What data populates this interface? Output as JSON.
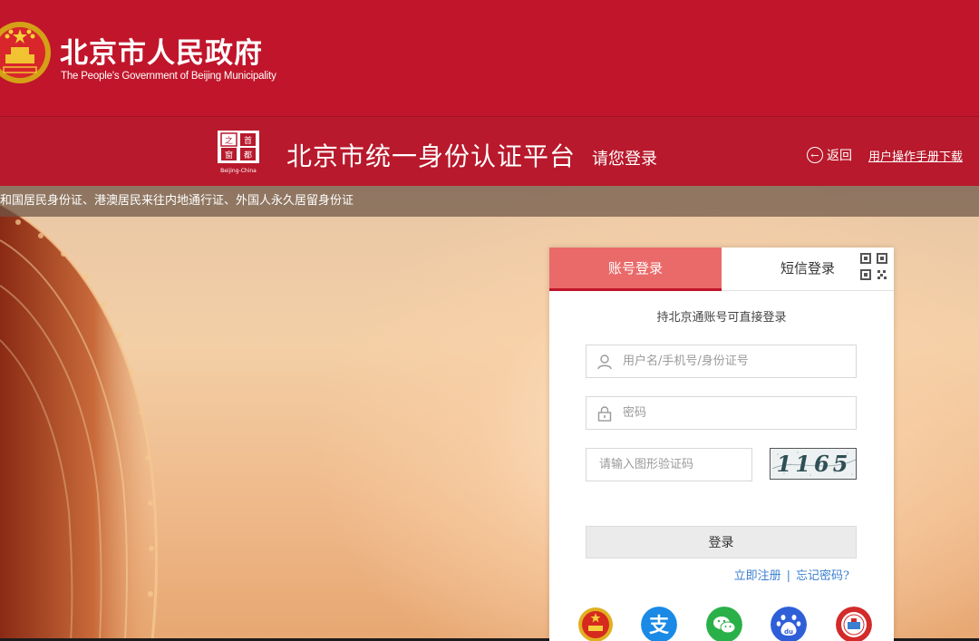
{
  "header": {
    "title": "北京市人民政府",
    "subtitle": "The People's Government of Beijing Municipality",
    "emblem_icon": "national-emblem-icon"
  },
  "platform": {
    "logo_icon": "capital-logo-icon",
    "logo_text": "Beijing-China",
    "title": "北京市统一身份认证平台",
    "subtitle": "请您登录",
    "back_label": "返回",
    "manual_label": "用户操作手册下载"
  },
  "notice": {
    "text": "和国居民身份证、港澳居民来往内地通行证、外国人永久居留身份证"
  },
  "login": {
    "tabs": [
      {
        "label": "账号登录",
        "active": true
      },
      {
        "label": "短信登录",
        "active": false
      }
    ],
    "qr_icon": "qrcode-icon",
    "hint": "持北京通账号可直接登录",
    "username": {
      "placeholder": "用户名/手机号/身份证号",
      "value": ""
    },
    "password": {
      "placeholder": "密码",
      "value": ""
    },
    "captcha": {
      "placeholder": "请输入图形验证码",
      "value": "",
      "image_text": "1165"
    },
    "submit_label": "登录",
    "register_label": "立即注册",
    "separator": "|",
    "forgot_label": "忘记密码?",
    "third_party": [
      {
        "name": "gov-emblem-login-icon",
        "color": "#d62a1e"
      },
      {
        "name": "alipay-icon",
        "color": "#1a8ae6"
      },
      {
        "name": "wechat-icon",
        "color": "#2ab048"
      },
      {
        "name": "baidu-icon",
        "color": "#2f5fd8"
      },
      {
        "name": "social-security-icon",
        "color": "#d32a2a"
      }
    ]
  },
  "colors": {
    "brand_red": "#c1152b",
    "tab_active": "#ea6a6a",
    "link_blue": "#3a7fd0"
  }
}
